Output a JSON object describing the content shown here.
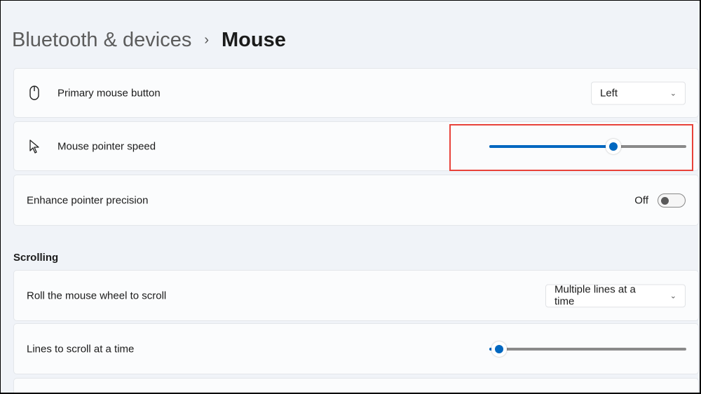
{
  "breadcrumb": {
    "parent": "Bluetooth & devices",
    "separator": "›",
    "current": "Mouse"
  },
  "settings": {
    "primary_button": {
      "label": "Primary mouse button",
      "value": "Left",
      "icon": "mouse-icon"
    },
    "pointer_speed": {
      "label": "Mouse pointer speed",
      "value_fraction": 0.63,
      "icon": "pointer-icon"
    },
    "precision": {
      "label": "Enhance pointer precision",
      "state": "Off"
    }
  },
  "scrolling": {
    "title": "Scrolling",
    "wheel": {
      "label": "Roll the mouse wheel to scroll",
      "value": "Multiple lines at a time"
    },
    "lines": {
      "label": "Lines to scroll at a time",
      "value_fraction": 0.05
    }
  },
  "colors": {
    "accent": "#0067c0",
    "highlight": "#e8423a"
  }
}
